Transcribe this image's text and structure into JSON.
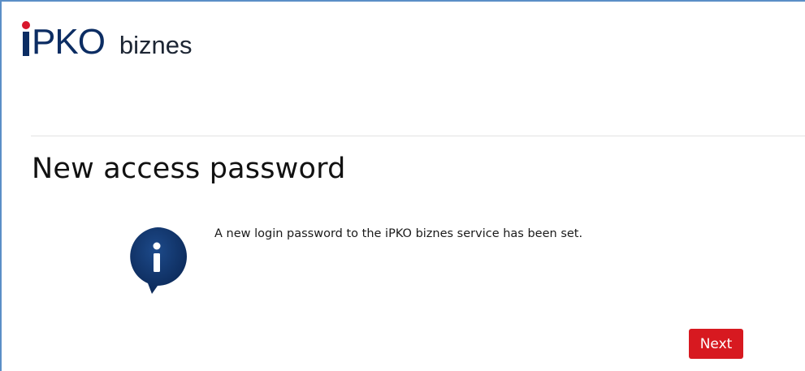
{
  "header": {
    "logo_text": "PKO",
    "logo_suffix": "biznes"
  },
  "main": {
    "title": "New access password",
    "message": "A new login password to the iPKO biznes service has been set.",
    "info_icon": "info-icon"
  },
  "actions": {
    "next_label": "Next"
  },
  "colors": {
    "brand_navy": "#0c2d63",
    "brand_red": "#d71920",
    "frame_border": "#5b8fc7"
  }
}
